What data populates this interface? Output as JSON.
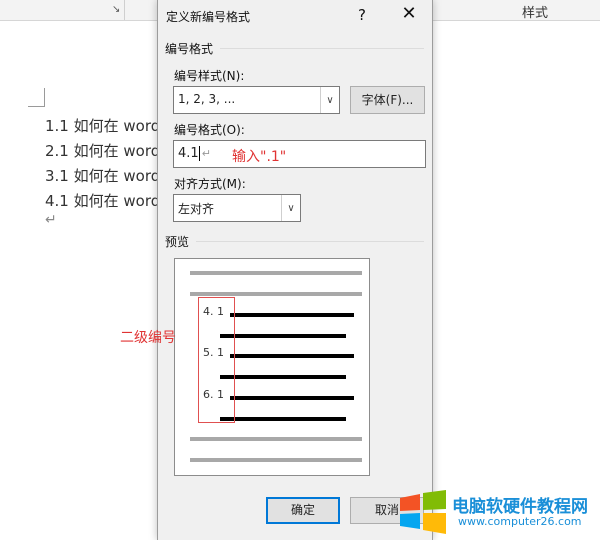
{
  "ribbon": {
    "styles_label": "样式",
    "launcher_glyph": "↘"
  },
  "document": {
    "lines": [
      "1.1 如何在 word",
      "2.1 如何在 word",
      "3.1 如何在 word",
      "4.1 如何在 word"
    ],
    "para_mark": "↵"
  },
  "dialog": {
    "title": "定义新编号格式",
    "help": "?",
    "close": "✕",
    "group_numbering": "编号格式",
    "style_label": "编号样式(N):",
    "style_value": "1, 2, 3, ...",
    "font_button": "字体(F)...",
    "format_label": "编号格式(O):",
    "format_value": "4.1",
    "format_mark": "↵",
    "align_label": "对齐方式(M):",
    "align_value": "左对齐",
    "preview_label": "预览",
    "preview_numbers": [
      "4. 1",
      "5. 1",
      "6. 1"
    ],
    "ok_button": "确定",
    "cancel_button": "取消"
  },
  "annotations": {
    "input_hint": "输入\".1\"",
    "level2": "二级编号"
  },
  "watermark": {
    "title": "电脑软硬件教程网",
    "url": "www.computer26.com"
  },
  "colors": {
    "accent": "#0078d7",
    "annotation": "#e03333",
    "watermark": "#1a8fd8"
  }
}
